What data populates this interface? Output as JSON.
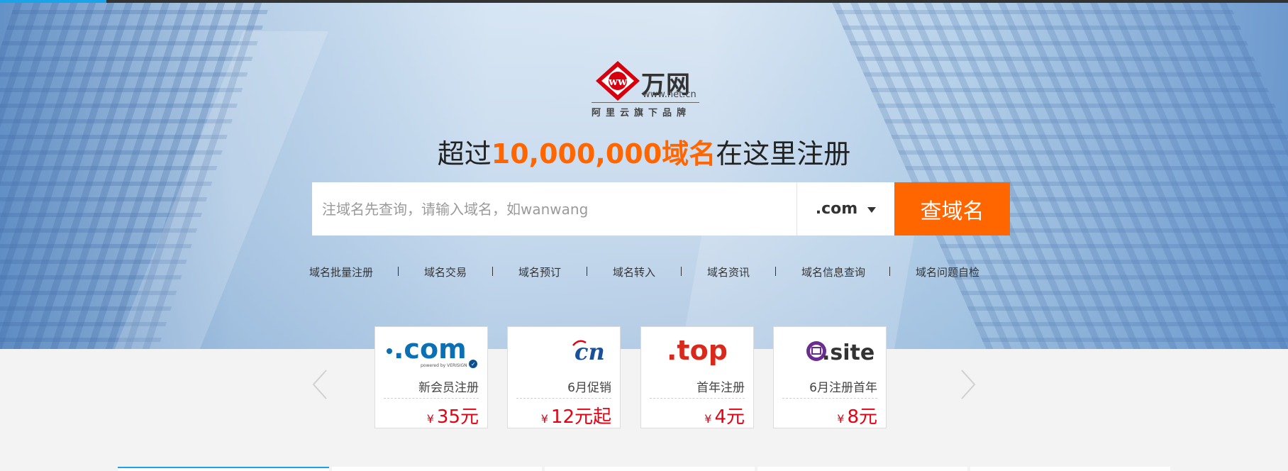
{
  "brand": {
    "name": "万网",
    "url": "www.net.cn",
    "slogan": "阿里云旗下品牌"
  },
  "headline": {
    "prefix": "超过",
    "highlight": "10,000,000域名",
    "suffix": "在这里注册"
  },
  "search": {
    "placeholder": "注域名先查询，请输入域名，如wanwang",
    "value": "",
    "tld_selected": ".com",
    "button_label": "查域名"
  },
  "quick_links": [
    {
      "label": "域名批量注册"
    },
    {
      "label": "域名交易"
    },
    {
      "label": "域名预订"
    },
    {
      "label": "域名转入"
    },
    {
      "label": "域名资讯"
    },
    {
      "label": "域名信息查询"
    },
    {
      "label": "域名问题自检"
    }
  ],
  "promos": [
    {
      "tld_logo": ".com",
      "logo_caption": "powered by VERISIGN",
      "desc": "新会员注册",
      "currency": "¥",
      "price": "35元"
    },
    {
      "tld_logo": "cn",
      "desc": "6月促销",
      "currency": "¥",
      "price": "12元起"
    },
    {
      "tld_logo": ".top",
      "desc": "首年注册",
      "currency": "¥",
      "price": "4元"
    },
    {
      "tld_logo": ".site",
      "desc": "6月注册首年",
      "currency": "¥",
      "price": "8元"
    }
  ],
  "icons": {
    "prev": "chevron-left-icon",
    "next": "chevron-right-icon",
    "dropdown": "caret-down-icon"
  },
  "colors": {
    "accent": "#ff6600",
    "price": "#e60012",
    "topbar_accent": "#1aa3e8",
    "brand_red": "#d7000f"
  }
}
